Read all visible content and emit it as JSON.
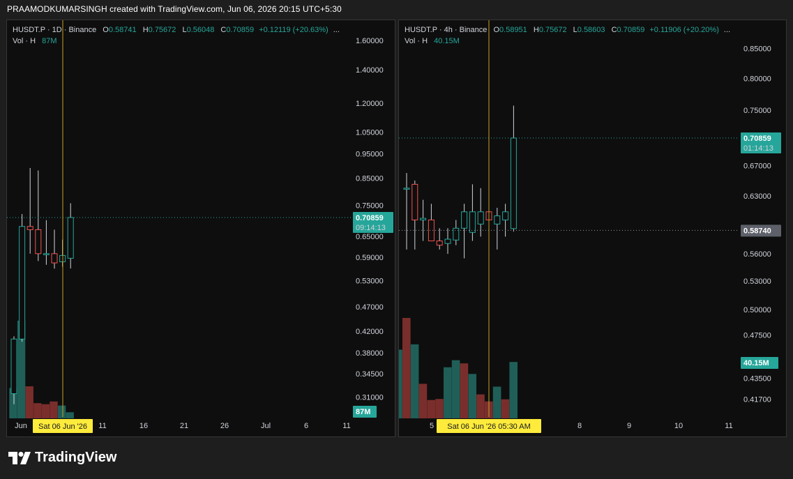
{
  "header": {
    "title": "PRAAMODKUMARSINGH created with TradingView.com, Jun 06, 2026 20:15 UTC+5:30"
  },
  "colors": {
    "up": "#26a69a",
    "down": "#ef5350",
    "vol_up": "#1f5f58",
    "vol_down": "#7a2e2c",
    "crosshair": "#c9a227",
    "time_tag_bg": "#ffeb3b",
    "gray_tag_bg": "#5d6069"
  },
  "left_panel": {
    "legend": {
      "symbol": "HUSDT.P · 1D · Binance",
      "o_key": "O",
      "o": "0.58741",
      "h_key": "H",
      "h": "0.75672",
      "l_key": "L",
      "l": "0.56048",
      "c_key": "C",
      "c": "0.70859",
      "change": "+0.12119 (+20.63%)",
      "more": "...",
      "vol_label": "Vol · H",
      "vol_value": "87M"
    },
    "y_ticks": [
      "1.60000",
      "1.40000",
      "1.20000",
      "1.05000",
      "0.95000",
      "0.85000",
      "0.75000",
      "0.65000",
      "0.59000",
      "0.53000",
      "0.47000",
      "0.42000",
      "0.38000",
      "0.34500",
      "0.31000"
    ],
    "x_ticks": [
      "Jun",
      "11",
      "16",
      "21",
      "26",
      "Jul",
      "6",
      "11"
    ],
    "price_tag": {
      "price": "0.70859",
      "countdown": "09:14:13"
    },
    "volume_tag": "87M",
    "time_tag": "Sat 06 Jun '26"
  },
  "right_panel": {
    "legend": {
      "symbol": "HUSDT.P · 4h · Binance",
      "o_key": "O",
      "o": "0.58951",
      "h_key": "H",
      "h": "0.75672",
      "l_key": "L",
      "l": "0.58603",
      "c_key": "C",
      "c": "0.70859",
      "change": "+0.11906 (+20.20%)",
      "more": "...",
      "vol_label": "Vol · H",
      "vol_value": "40.15M"
    },
    "y_ticks": [
      "0.85000",
      "0.80000",
      "0.75000",
      "0.67000",
      "0.63000",
      "0.56000",
      "0.53000",
      "0.50000",
      "0.47500",
      "0.43500",
      "0.41700"
    ],
    "x_ticks": [
      "5",
      "8",
      "9",
      "10",
      "11"
    ],
    "price_tag": {
      "price": "0.70859",
      "countdown": "01:14:13"
    },
    "open_tag": "0.58740",
    "volume_tag": "40.15M",
    "time_tag": "Sat 06 Jun '26   05:30 AM"
  },
  "chart_data": [
    {
      "type": "candlestick",
      "symbol": "HUSDT.P",
      "interval": "1D",
      "y_scale": "log",
      "ylim": [
        0.295,
        1.68
      ],
      "candles": [
        {
          "o": 0.315,
          "h": 0.41,
          "l": 0.3,
          "c": 0.405
        },
        {
          "o": 0.405,
          "h": 0.72,
          "l": 0.4,
          "c": 0.68
        },
        {
          "o": 0.68,
          "h": 0.89,
          "l": 0.6,
          "c": 0.67
        },
        {
          "o": 0.67,
          "h": 0.88,
          "l": 0.58,
          "c": 0.6
        },
        {
          "o": 0.6,
          "h": 0.7,
          "l": 0.57,
          "c": 0.6
        },
        {
          "o": 0.6,
          "h": 0.67,
          "l": 0.56,
          "c": 0.575
        },
        {
          "o": 0.578,
          "h": 0.64,
          "l": 0.565,
          "c": 0.595
        },
        {
          "o": 0.58741,
          "h": 0.75672,
          "l": 0.56048,
          "c": 0.70859
        }
      ],
      "volumes": [
        0.9,
        2.9,
        0.95,
        0.45,
        0.42,
        0.5,
        0.38,
        0.18
      ],
      "vol_max": 3.0
    },
    {
      "type": "candlestick",
      "symbol": "HUSDT.P",
      "interval": "4h",
      "y_scale": "log",
      "ylim": [
        0.405,
        0.89
      ],
      "candles": [
        {
          "o": 0.64,
          "h": 0.66,
          "l": 0.565,
          "c": 0.64
        },
        {
          "o": 0.645,
          "h": 0.65,
          "l": 0.565,
          "c": 0.6
        },
        {
          "o": 0.6,
          "h": 0.625,
          "l": 0.575,
          "c": 0.602
        },
        {
          "o": 0.6,
          "h": 0.62,
          "l": 0.578,
          "c": 0.575
        },
        {
          "o": 0.575,
          "h": 0.59,
          "l": 0.565,
          "c": 0.57
        },
        {
          "o": 0.572,
          "h": 0.59,
          "l": 0.56,
          "c": 0.577
        },
        {
          "o": 0.576,
          "h": 0.6,
          "l": 0.57,
          "c": 0.59
        },
        {
          "o": 0.59,
          "h": 0.62,
          "l": 0.555,
          "c": 0.61
        },
        {
          "o": 0.585,
          "h": 0.645,
          "l": 0.575,
          "c": 0.61
        },
        {
          "o": 0.595,
          "h": 0.64,
          "l": 0.58,
          "c": 0.61
        },
        {
          "o": 0.61,
          "h": 0.63,
          "l": 0.575,
          "c": 0.6
        },
        {
          "o": 0.595,
          "h": 0.615,
          "l": 0.565,
          "c": 0.605
        },
        {
          "o": 0.6,
          "h": 0.62,
          "l": 0.58,
          "c": 0.61
        },
        {
          "o": 0.58951,
          "h": 0.75672,
          "l": 0.58603,
          "c": 0.70859
        }
      ],
      "volumes": [
        19.5,
        28.5,
        21.0,
        9.8,
        5.2,
        5.5,
        14.5,
        16.5,
        15.6,
        12.6,
        6.8,
        4.8,
        9.0,
        5.4,
        16.0
      ],
      "vol_max": 28.5
    }
  ]
}
